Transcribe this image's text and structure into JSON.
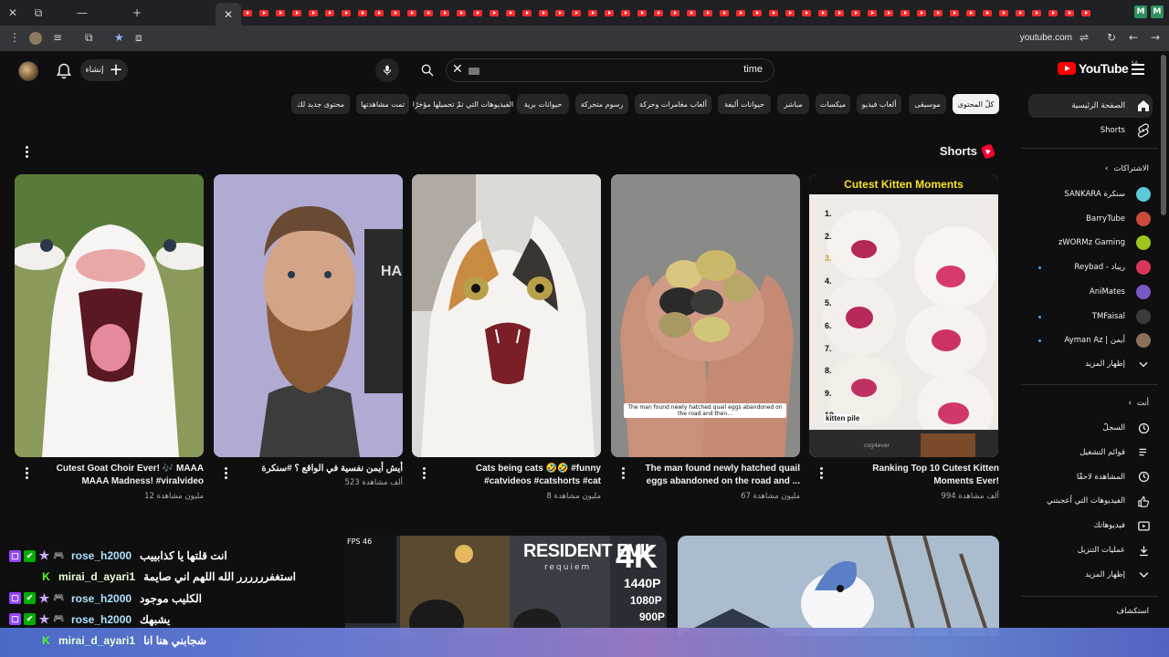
{
  "browser": {
    "url": "youtube.com",
    "tab_right_labels": [
      "M",
      "M"
    ]
  },
  "masthead": {
    "create_label": "إنشاء",
    "search_query": "time",
    "logo_text": "YouTube",
    "country_code": "SA"
  },
  "chips": [
    {
      "label": "كلّ المحتوى",
      "active": true
    },
    {
      "label": "موسيقى"
    },
    {
      "label": "ألعاب فيديو"
    },
    {
      "label": "ميكسات"
    },
    {
      "label": "مباشر"
    },
    {
      "label": "حيوانات أليفة"
    },
    {
      "label": "ألعاب مغامرات وحركة"
    },
    {
      "label": "رسوم متحركة"
    },
    {
      "label": "حيوانات برية"
    },
    {
      "label": "الفيديوهات التي تمّ تحميلها مؤخرًا"
    },
    {
      "label": "تمت مشاهدتها"
    },
    {
      "label": "محتوى جديد لك"
    }
  ],
  "sidebar": {
    "home": "الصفحة الرئيسية",
    "shorts": "Shorts",
    "subscriptions_header": "الاشتراكات",
    "channels": [
      {
        "name": "SANKARA سنكرة",
        "color": "#5cc9d6"
      },
      {
        "name": "BarryTube",
        "color": "#c94a3a"
      },
      {
        "name": "zWORMz Gaming",
        "color": "#9cc61d"
      },
      {
        "name": "Reybad - ريباد",
        "color": "#d8365a"
      },
      {
        "name": "AniMates",
        "color": "#7a58c7"
      },
      {
        "name": "TMFaisal",
        "color": "#3b3b3b"
      },
      {
        "name": "Ayman Az | أيمن",
        "color": "#8a6f5a"
      }
    ],
    "show_more": "إظهار المزيد",
    "you_header": "أنت",
    "you_items": [
      {
        "label": "السجلّ",
        "icon": "history-icon"
      },
      {
        "label": "قوائم التشغيل",
        "icon": "playlist-icon"
      },
      {
        "label": "المشاهدة لاحقًا",
        "icon": "watch-later-icon"
      },
      {
        "label": "الفيديوهات التي أعجبتني",
        "icon": "like-icon"
      },
      {
        "label": "فيديوهاتك",
        "icon": "your-videos-icon"
      },
      {
        "label": "عمليات التنزيل",
        "icon": "download-icon"
      },
      {
        "label": "إظهار المزيد",
        "icon": "chevron-down-icon"
      }
    ],
    "explore_header": "استكشاف"
  },
  "shorts": {
    "section_title": "Shorts",
    "items": [
      {
        "title_line1": "Ranking Top 10 Cutest Kitten",
        "title_line2": "Moments Ever!",
        "views": "994 ألف مشاهدة"
      },
      {
        "title_line1": "The man found newly hatched quail",
        "title_line2": "eggs abandoned on the road and ...",
        "views": "67 مليون مشاهدة"
      },
      {
        "title_line1": "Cats being cats 🤣🤣 #funny",
        "title_line2": "#catvideos #catshorts #cat",
        "views": "8 مليون مشاهدة"
      },
      {
        "title_line1": "أيش أيمن نفسية في الواقع ؟ #سنكرة",
        "title_line2": "",
        "views": "523 ألف مشاهدة"
      },
      {
        "title_line1": "Cutest Goat Choir Ever! 🎶 MAAA",
        "title_line2": "MAAA Madness! #viralvideo",
        "views": "12 مليون مشاهدة"
      }
    ],
    "thumb_texts": {
      "kitten_header": "Cutest Kitten Moments",
      "kitten_numbers": [
        "1.",
        "2.",
        "3.",
        "4.",
        "5.",
        "6.",
        "7.",
        "8.",
        "9.",
        "10."
      ],
      "kitten_pile": "kitten pile",
      "kitten_watermark": "cog4ever",
      "quail_caption": "The man found newly hatched quail eggs abandoned on the road and then...",
      "beard_text": "HA"
    }
  },
  "bottom_videos": {
    "re_title": "RESIDENT EVIL",
    "re_subtitle": "requiem",
    "re_4k": "4K",
    "re_res": [
      "1440P",
      "1080P",
      "900P"
    ],
    "fps_label": "FPS 46"
  },
  "chat": [
    {
      "name": "rose_h2000",
      "msg": "انت قلتها يا كذابييب",
      "badges": [
        "twitch",
        "mod",
        "star",
        "controller"
      ]
    },
    {
      "name": "mirai_d_ayari1",
      "msg": "استغفرررررر الله اللهم اني صايمة",
      "badges": [
        "kick"
      ]
    },
    {
      "name": "rose_h2000",
      "msg": "الكليب موجود",
      "badges": [
        "twitch",
        "mod",
        "star",
        "controller"
      ]
    },
    {
      "name": "rose_h2000",
      "msg": "يشبهك",
      "badges": [
        "twitch",
        "mod",
        "star",
        "controller"
      ]
    },
    {
      "name": "mirai_d_ayari1",
      "msg": "شجابني هنا انا",
      "badges": [
        "kick"
      ]
    }
  ],
  "colors": {
    "background": "#0f0f0f",
    "chip_bg": "#272727",
    "accent_red": "#ff0000",
    "chat_name": "#aee1ff",
    "twitch": "#9146ff",
    "kick": "#53fc18"
  }
}
